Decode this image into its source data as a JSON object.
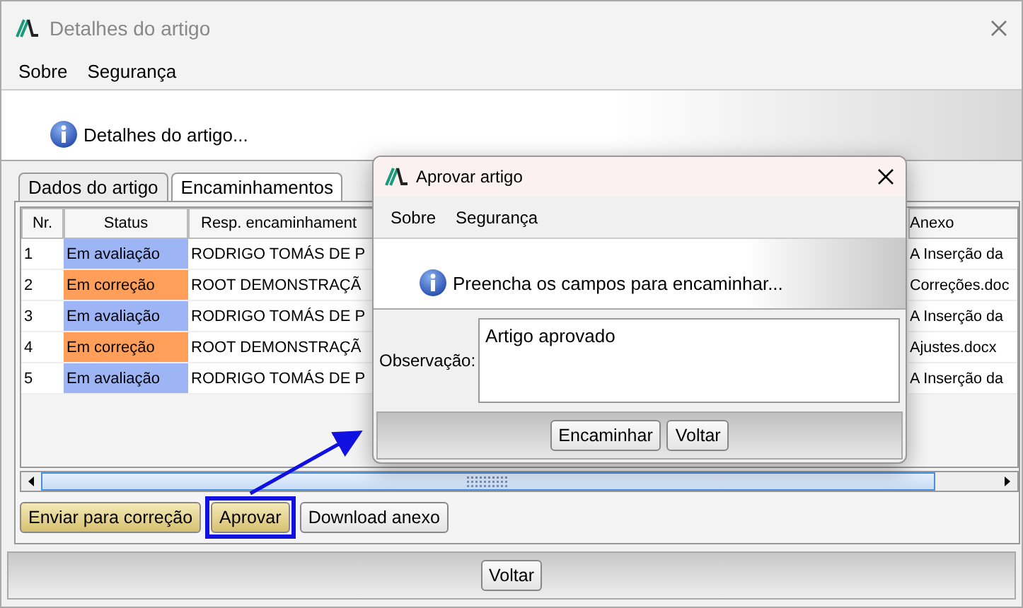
{
  "window": {
    "title": "Detalhes do artigo",
    "active": false
  },
  "menu": [
    "Sobre",
    "Segurança"
  ],
  "info": "Detalhes do artigo...",
  "tabs": [
    {
      "label": "Dados do artigo",
      "selected": false
    },
    {
      "label": "Encaminhamentos",
      "selected": true
    }
  ],
  "table": {
    "columns": [
      "Nr.",
      "Status",
      "Resp. encaminhament",
      "Anexo"
    ],
    "rows": [
      {
        "nr": "1",
        "status": "Em avaliação",
        "color": "#9db4f5",
        "resp": "RODRIGO TOMÁS DE P",
        "anexo": "A Inserção da"
      },
      {
        "nr": "2",
        "status": "Em correção",
        "color": "#ff9f5a",
        "resp": "ROOT DEMONSTRAÇÃ",
        "anexo": "Correções.doc"
      },
      {
        "nr": "3",
        "status": "Em avaliação",
        "color": "#9db4f5",
        "resp": "RODRIGO TOMÁS DE P",
        "anexo": "A Inserção da"
      },
      {
        "nr": "4",
        "status": "Em correção",
        "color": "#ff9f5a",
        "resp": "ROOT DEMONSTRAÇÃ",
        "anexo": "Ajustes.docx"
      },
      {
        "nr": "5",
        "status": "Em avaliação",
        "color": "#9db4f5",
        "resp": "RODRIGO TOMÁS DE P",
        "anexo": "A Inserção da"
      }
    ]
  },
  "actions": [
    {
      "label": "Enviar para correção",
      "kind": "gold",
      "highlighted": false
    },
    {
      "label": "Aprovar",
      "kind": "gold",
      "highlighted": true
    },
    {
      "label": "Download anexo",
      "kind": "plain",
      "highlighted": false
    }
  ],
  "footer_button": "Voltar",
  "dialog": {
    "title": "Aprovar artigo",
    "menu": [
      "Sobre",
      "Segurança"
    ],
    "info": "Preencha os campos para encaminhar...",
    "field_label": "Observação:",
    "field_value": "Artigo aprovado",
    "buttons": [
      "Encaminhar",
      "Voltar"
    ]
  }
}
